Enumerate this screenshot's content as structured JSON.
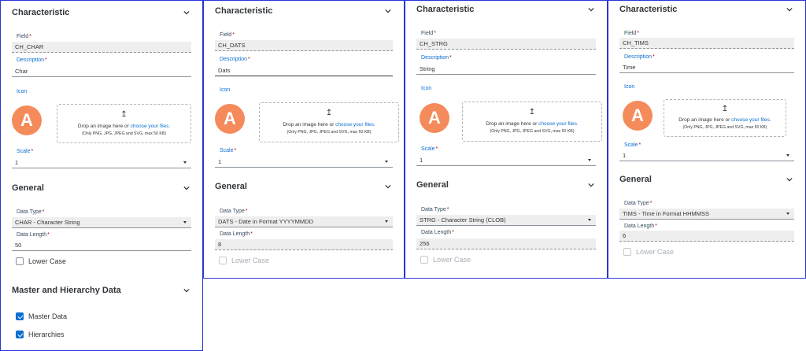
{
  "panels": [
    {
      "characteristic_title": "Characteristic",
      "field_label": "Field",
      "field_value": "CH_CHAR",
      "description_label": "Description",
      "description_value": "Char",
      "icon_label": "Icon",
      "avatar_letter": "A",
      "upload_symbol": "↥",
      "drop_text": "Drop an image here or",
      "drop_link": "choose your files.",
      "drop_hint": "(Only PNG, JPG, JPEG and SVG, max 50 KB)",
      "scale_label": "Scale",
      "scale_value": "1",
      "general_title": "General",
      "data_type_label": "Data Type",
      "data_type_value": "CHAR - Character String",
      "data_length_label": "Data Length",
      "data_length_value": "50",
      "lower_case_label": "Lower Case",
      "master_title": "Master and Hierarchy Data",
      "master_data_label": "Master Data",
      "hierarchies_label": "Hierarchies"
    },
    {
      "characteristic_title": "Characteristic",
      "field_label": "Field",
      "field_value": "CH_DATS",
      "description_label": "Description",
      "description_value": "Dats",
      "icon_label": "Icon",
      "avatar_letter": "A",
      "upload_symbol": "↥",
      "drop_text": "Drop an image here or",
      "drop_link": "choose your files.",
      "drop_hint": "(Only PNG, JPG, JPEG and SVG, max 50 KB)",
      "scale_label": "Scale",
      "scale_value": "1",
      "general_title": "General",
      "data_type_label": "Data Type",
      "data_type_value": "DATS - Date in Format YYYYMMDD",
      "data_length_label": "Data Length",
      "data_length_value": "8",
      "lower_case_label": "Lower Case"
    },
    {
      "characteristic_title": "Characteristic",
      "field_label": "Field",
      "field_value": "CH_STRG",
      "description_label": "Description",
      "description_value": "String",
      "icon_label": "Icon",
      "avatar_letter": "A",
      "upload_symbol": "↥",
      "drop_text": "Drop an image here or",
      "drop_link": "choose your files.",
      "drop_hint": "(Only PNG, JPG, JPEG and SVG, max 50 KB)",
      "scale_label": "Scale",
      "scale_value": "1",
      "general_title": "General",
      "data_type_label": "Data Type",
      "data_type_value": "STRG - Character String (CLOB)",
      "data_length_label": "Data Length",
      "data_length_value": "256",
      "lower_case_label": "Lower Case"
    },
    {
      "characteristic_title": "Characteristic",
      "field_label": "Field",
      "field_value": "CH_TIMS",
      "description_label": "Description",
      "description_value": "Time",
      "icon_label": "Icon",
      "avatar_letter": "A",
      "upload_symbol": "↥",
      "drop_text": "Drop an image here or",
      "drop_link": "choose your files.",
      "drop_hint": "(Only PNG, JPG, JPEG and SVG, max 50 KB)",
      "scale_label": "Scale",
      "scale_value": "1",
      "general_title": "General",
      "data_type_label": "Data Type",
      "data_type_value": "TIMS - Time in Format HHMMSS",
      "data_length_label": "Data Length",
      "data_length_value": "6",
      "lower_case_label": "Lower Case"
    }
  ],
  "required_marker": "*",
  "icons": {
    "chevron": "chevron-down-icon",
    "upload": "upload-icon",
    "dropdown": "dropdown-arrow-icon",
    "checkbox": "checkbox-icon"
  },
  "colors": {
    "panel_border": "#2a34d6",
    "accent": "#0a6ed1",
    "avatar": "#f58b5a",
    "required": "#bb0000"
  }
}
